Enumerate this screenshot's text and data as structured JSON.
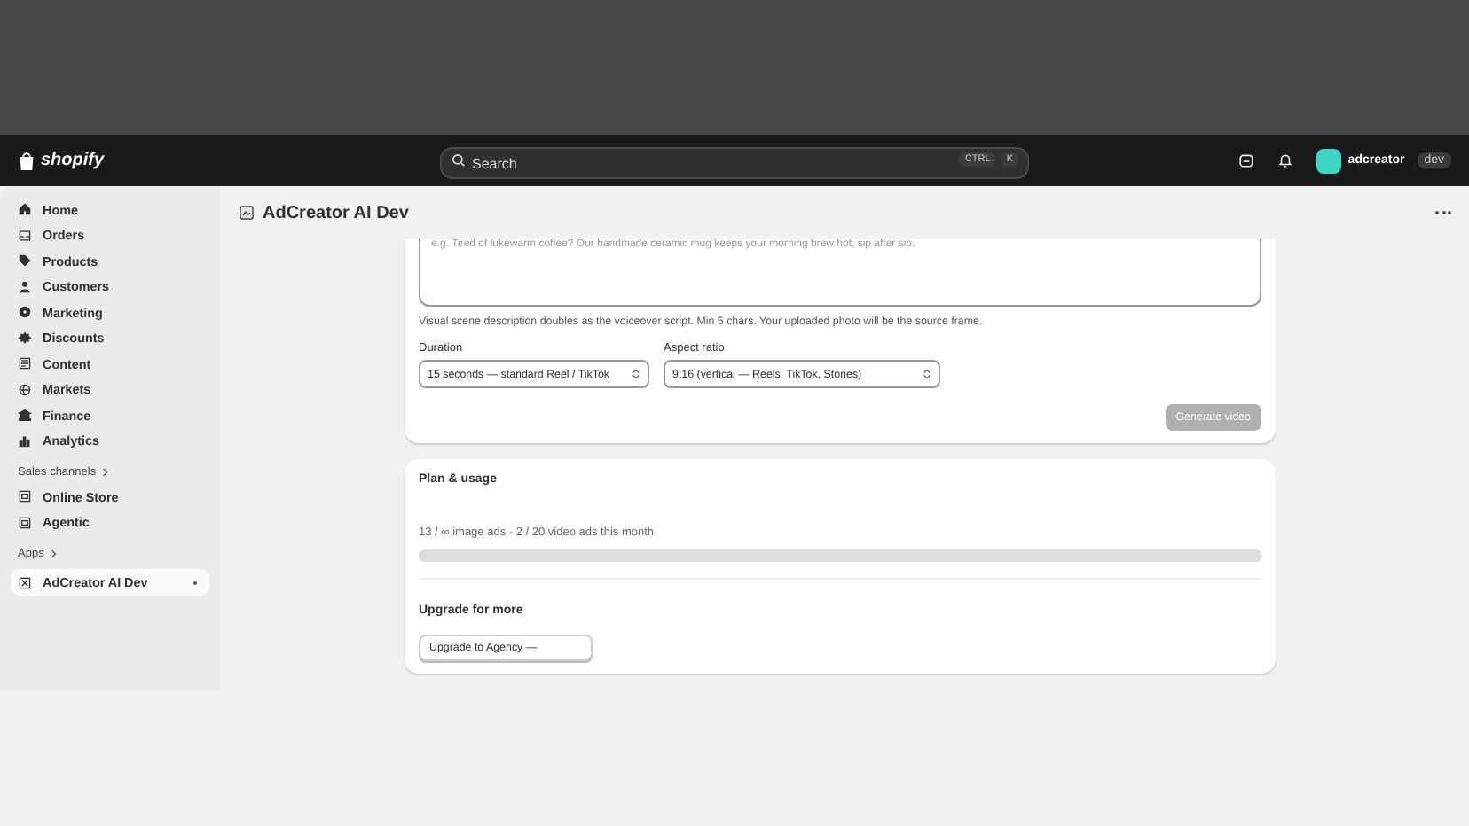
{
  "topbar": {
    "logo": "shopify",
    "search": {
      "placeholder": "Search",
      "shortcut_keys": [
        "CTRL",
        "K"
      ]
    },
    "store_name": "adcreator",
    "store_badge": "dev"
  },
  "sidebar": {
    "items": [
      {
        "label": "Home",
        "selected": false
      },
      {
        "label": "Orders",
        "selected": false
      },
      {
        "label": "Products",
        "selected": false
      },
      {
        "label": "Customers",
        "selected": false
      },
      {
        "label": "Marketing",
        "selected": false
      },
      {
        "label": "Discounts",
        "selected": false
      },
      {
        "label": "Content",
        "selected": false
      },
      {
        "label": "Markets",
        "selected": false
      },
      {
        "label": "Finance",
        "selected": false
      },
      {
        "label": "Analytics",
        "selected": false
      }
    ],
    "sales_channels": {
      "heading": "Sales channels",
      "items": [
        {
          "label": "Online Store",
          "selected": false
        },
        {
          "label": "Agentic",
          "selected": false
        }
      ]
    },
    "apps": {
      "heading": "Apps",
      "items": [
        {
          "label": "AdCreator AI Dev",
          "selected": true
        }
      ]
    }
  },
  "page": {
    "title": "AdCreator AI Dev"
  },
  "video_card": {
    "script_field": {
      "placeholder": "e.g. Tired of lukewarm coffee? Our handmade ceramic mug keeps your morning brew hot, sip after sip."
    },
    "help_text": "Visual scene description doubles as the voiceover script. Min 5 chars. Your uploaded photo will be the source frame.",
    "selects": [
      {
        "label": "Duration",
        "value": "15 seconds — standard Reel / TikTok"
      },
      {
        "label": "Aspect ratio",
        "value": "9:16 (vertical — Reels, TikTok, Stories)"
      }
    ],
    "generate_button": {
      "label": "Generate video",
      "disabled": true
    }
  },
  "plan_card": {
    "title": "Plan & usage",
    "usage_text": "13 / ∞ image ads · 2 / 20 video ads this month",
    "upgrade_heading": "Upgrade for more",
    "upgrade_button": "Upgrade to Agency —"
  }
}
